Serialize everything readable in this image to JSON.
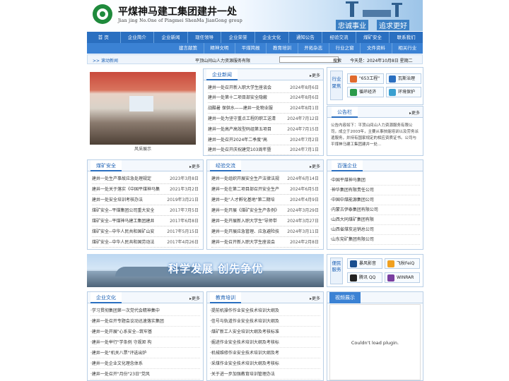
{
  "header": {
    "title_cn": "平煤神马建工集团建井一处",
    "title_en": "Jian jing No.One of Pingmei ShenMa JianGong group",
    "slogan_1": "忠诚事业",
    "slogan_2": "追求更好"
  },
  "nav_row1": [
    "首 页",
    "企业简介",
    "企业新闻",
    "现任领导",
    "企业荣誉",
    "企业文化",
    "通知公告",
    "经验交流",
    "煤矿安全",
    "联系我们"
  ],
  "nav_row2": [
    "建言献策",
    "精神文明",
    "平煤简报",
    "教育培训",
    "开拓杂志",
    "行业之窗",
    "文件资料",
    "相关行业"
  ],
  "info_bar": {
    "marquee": ">> 滚动新闻",
    "notice": "平顶山间山人力资源服务有限",
    "search_label": "搜索",
    "date": "今天是：2024年10月8日 星期二"
  },
  "photo_caption": "风采展示",
  "company_news": {
    "title": "企业新闻",
    "more": "更多",
    "items": [
      {
        "t": "建井一处召开新入职大学生座谈会",
        "d": "2024年8月6日"
      },
      {
        "t": "建井一处第十二项目部安全隐蔽",
        "d": "2024年8月6日"
      },
      {
        "t": "战酷暑 保供水——建井一处物业服",
        "d": "2024年8月1日"
      },
      {
        "t": "建井一处为坚守重点工程的职工送清",
        "d": "2024年7月12日"
      },
      {
        "t": "建井一处高产高效型码组第五项目",
        "d": "2024年7月15日"
      },
      {
        "t": "建井一处召开2024年二季度\"高",
        "d": "2024年7月2日"
      },
      {
        "t": "建井一处召开庆祝建党103周年暨",
        "d": "2024年7月1日"
      }
    ]
  },
  "quick_links": {
    "label": "行业聚焦",
    "buttons": [
      "\"653工程\"",
      "瓦斯治理",
      "循环经济",
      "环境保护"
    ]
  },
  "bulletin": {
    "title": "公告栏",
    "more": "更多",
    "text": "公告内容如下：平顶山间山人力资源服务有限公司，成立于2003年，主要从事技能培训以及劳务派遣服务，并持有国家规定的相应资质证书。公司与平煤神马建工集团建井一处..."
  },
  "mine_safety": {
    "title": "煤矿安全",
    "more": "更多",
    "items": [
      {
        "t": "建井一处生产事故应急处理规定",
        "d": "2023年3月8日"
      },
      {
        "t": "建井一处关于落实《中国平煤神马集",
        "d": "2021年3月2日"
      },
      {
        "t": "建井一处安全培训考核办法",
        "d": "2019年3月21日"
      },
      {
        "t": "煤矿安全--平煤集团公司重大安全",
        "d": "2017年7月5日"
      },
      {
        "t": "煤矿安全--平煤神马建工集团建井",
        "d": "2017年6月8日"
      },
      {
        "t": "煤矿安全--中华人民共和国矿山安",
        "d": "2017年5月15日"
      },
      {
        "t": "煤矿安全--中华人民共和国劳动法",
        "d": "2017年4月26日"
      }
    ]
  },
  "experience": {
    "title": "经验交流",
    "more": "更多",
    "items": [
      {
        "t": "建井一处组织开展安全生产法律法规",
        "d": "2024年6月14日"
      },
      {
        "t": "建井一处在第二项目部召开安全生产",
        "d": "2024年6月5日"
      },
      {
        "t": "建井一处\"人才孵化基地\"第二期培",
        "d": "2024年4月9日"
      },
      {
        "t": "建井一处开展《煤矿安全生产条例》",
        "d": "2024年3月29日"
      },
      {
        "t": "建井一处开展新入职大学生\"导师带",
        "d": "2024年3月27日"
      },
      {
        "t": "建井一处开展应急管理、应急避险技",
        "d": "2024年3月11日"
      },
      {
        "t": "建井一处召开新入职大学生座谈会",
        "d": "2024年2月8日"
      }
    ]
  },
  "partners": {
    "title": "百强企业",
    "items": [
      "·中国平煤神马集团",
      "·神华集团有限责任公司",
      "·中国中煤能源集团公司",
      "·内蒙古伊泰集团有限公司",
      "·山西大同煤矿集团有限",
      "·山西省煤炭运销总公司",
      "·山东兖矿集团有限公司"
    ]
  },
  "banner": {
    "text": "科学发展  创先争优"
  },
  "tools": {
    "label": "便民服务",
    "buttons": [
      "暴风影音",
      "飞秋FeiQ",
      "腾讯 QQ",
      "WINRAR"
    ]
  },
  "culture": {
    "title": "企业文化",
    "more": "更多",
    "items": [
      "·学习贯彻集团第一次党代会精神集中",
      "·建井一处召开专题会议动迅速落实集团",
      "·建井一处开展\"心系安全--筑牢基",
      "·建井一处举行\"学条例 守规矩 构",
      "·建井一处\"机关八票\"评选出炉",
      "·建井一处企业文化理念体系",
      "·建井一处召开\"月份\"23日\"党风"
    ]
  },
  "training": {
    "title": "教育培训",
    "more": "更多",
    "items": [
      "·提前机操作作业安全技术培训大纲及",
      "·信号与轨道作业安全技术培训大纲及",
      "·煤矿新工人安全培训大纲及考核标准",
      "·掘进作业安全技术培训大纲及考核标",
      "·机械维修作业安全技术培训大纲及考",
      "·采煤作业安全技术培训大纲及考核标",
      "·关于进一步加强教育培训管理办法"
    ]
  },
  "video": {
    "title": "视频展示",
    "message": "Couldn't load plugin."
  }
}
